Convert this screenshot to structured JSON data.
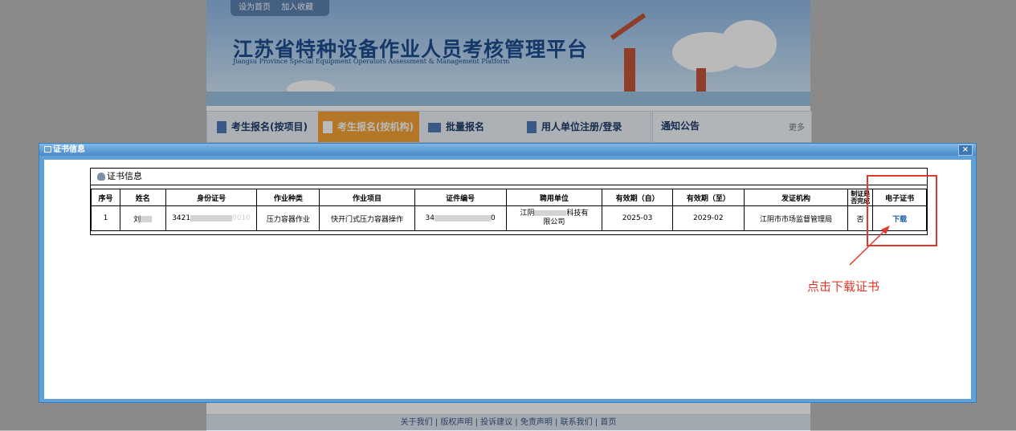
{
  "site": {
    "top_links": [
      "设为首页",
      "加入收藏"
    ],
    "title": "江苏省特种设备作业人员考核管理平台",
    "subtitle": "Jiangsu Province Special Equipment Operators Assessment & Management Platform",
    "nav_tabs": [
      {
        "label": "考生报名(按项目)",
        "active": false
      },
      {
        "label": "考生报名(按机构)",
        "active": true
      },
      {
        "label": "批量报名",
        "active": false
      },
      {
        "label": "用人单位注册/登录",
        "active": false
      }
    ],
    "notice_title": "通知公告",
    "notice_more": "更多",
    "footer_links": [
      "关于我们",
      "版权声明",
      "投诉建议",
      "免责声明",
      "联系我们",
      "首页"
    ]
  },
  "dialog": {
    "title": "证书信息",
    "close_glyph": "×",
    "caption": "证书信息",
    "columns": [
      "序号",
      "姓名",
      "身份证号",
      "作业种类",
      "作业项目",
      "证件编号",
      "聘用单位",
      "有效期（自）",
      "有效期（至）",
      "发证机构",
      "制证是否完成",
      "电子证书"
    ],
    "row": {
      "index": "1",
      "name": "刘",
      "id_prefix": "3421",
      "id_suffix": "0010",
      "category": "压力容器作业",
      "item": "快开门式压力容器操作",
      "cert_prefix": "34",
      "cert_suffix": "0",
      "employer_left": "江阴",
      "employer_right": "科技有",
      "employer_line2": "限公司",
      "valid_from": "2025-03",
      "valid_to": "2029-02",
      "issuer": "江阴市市场监督管理局",
      "made": "否",
      "download": "下载"
    }
  },
  "annotation": {
    "text": "点击下载证书",
    "color": "#e0392b"
  },
  "colors": {
    "dialog_border": "#5fa0d8",
    "nav_active": "#f7a438",
    "link": "#1f5fa8"
  }
}
